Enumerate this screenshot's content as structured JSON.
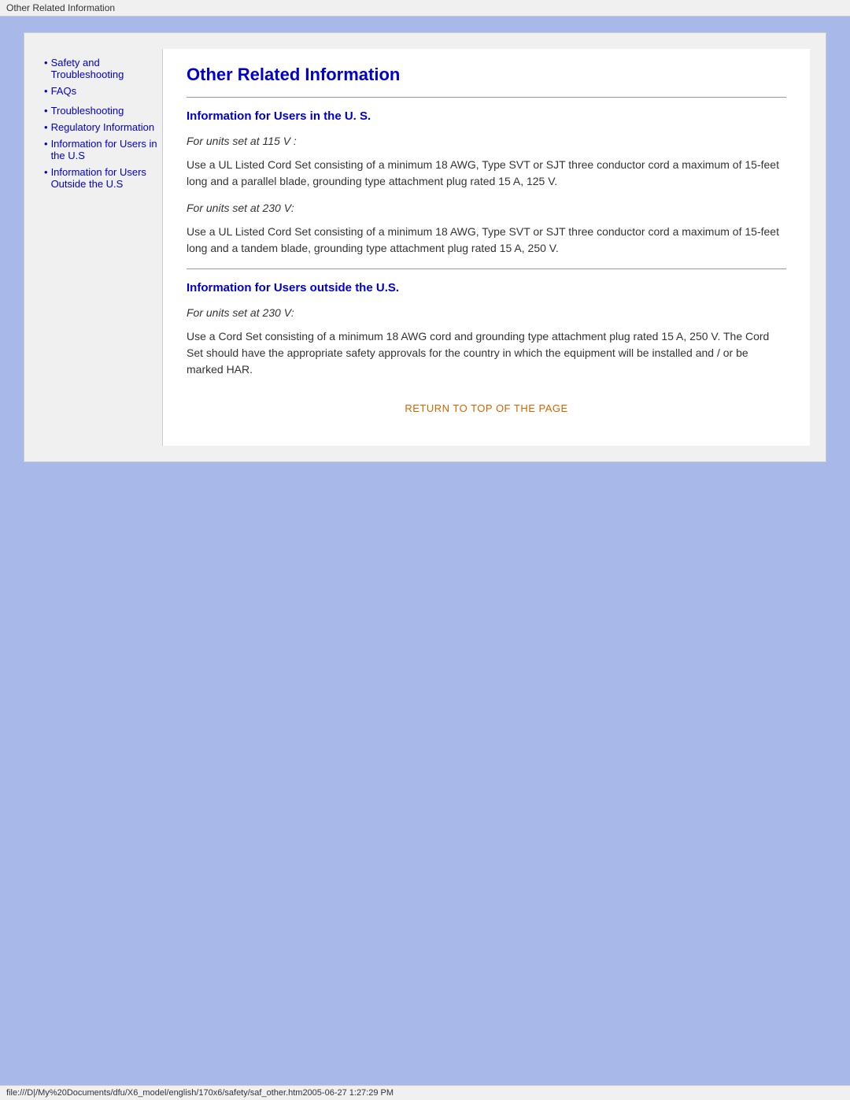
{
  "title_bar": {
    "text": "Other Related Information"
  },
  "sidebar": {
    "items": [
      {
        "id": "safety-troubleshooting",
        "label": "Safety and Troubleshooting",
        "bullet": true
      },
      {
        "id": "faqs",
        "label": "FAQs",
        "bullet": true
      },
      {
        "id": "troubleshooting",
        "label": "Troubleshooting",
        "bullet": true
      },
      {
        "id": "regulatory-information",
        "label": "Regulatory Information",
        "bullet": true
      },
      {
        "id": "information-users-us",
        "label": "Information for Users in the U.S",
        "bullet": true
      },
      {
        "id": "information-users-outside-us",
        "label": "Information for Users Outside the U.S",
        "bullet": true
      }
    ]
  },
  "content": {
    "page_title": "Other Related Information",
    "section1": {
      "title": "Information for Users in the U. S.",
      "subsection1": {
        "label": "For units set at 115 V :",
        "body": "Use a UL Listed Cord Set consisting of a minimum 18 AWG, Type SVT or SJT three conductor cord a maximum of 15-feet long and a parallel blade, grounding type attachment plug rated 15 A, 125 V."
      },
      "subsection2": {
        "label": "For units set at 230 V:",
        "body": "Use a UL Listed Cord Set consisting of a minimum 18 AWG, Type SVT or SJT three conductor cord a maximum of 15-feet long and a tandem blade, grounding type attachment plug rated 15 A, 250 V."
      }
    },
    "section2": {
      "title": "Information for Users outside the U.S.",
      "subsection1": {
        "label": "For units set at 230 V:",
        "body": "Use a Cord Set consisting of a minimum 18 AWG cord and grounding type attachment plug rated 15 A, 250 V. The Cord Set should have the appropriate safety approvals for the country in which the equipment will be installed and / or be marked HAR."
      }
    },
    "return_link": "RETURN TO TOP OF THE PAGE"
  },
  "status_bar": {
    "text": "file:///D|/My%20Documents/dfu/X6_model/english/170x6/safety/saf_other.htm2005-06-27  1:27:29 PM"
  }
}
